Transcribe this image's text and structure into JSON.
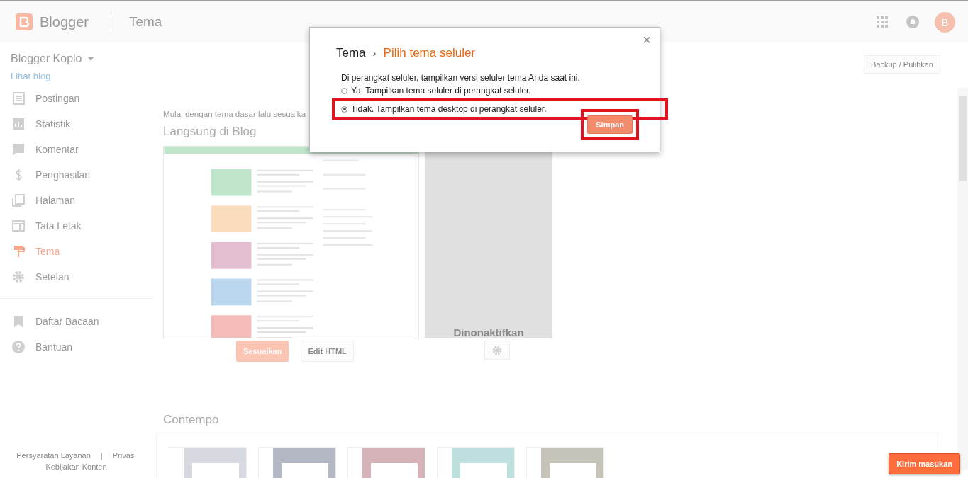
{
  "header": {
    "logo_text": "Blogger",
    "page_title": "Tema",
    "avatar_letter": "B"
  },
  "sidebar": {
    "blog_name": "Blogger Koplo",
    "view_blog_link": "Lihat blog",
    "items": [
      {
        "label": "Postingan",
        "kind": "posts",
        "selected": false
      },
      {
        "label": "Statistik",
        "kind": "stats",
        "selected": false
      },
      {
        "label": "Komentar",
        "kind": "comments",
        "selected": false
      },
      {
        "label": "Penghasilan",
        "kind": "earnings",
        "selected": false
      },
      {
        "label": "Halaman",
        "kind": "pages",
        "selected": false
      },
      {
        "label": "Tata Letak",
        "kind": "layout",
        "selected": false
      },
      {
        "label": "Tema",
        "kind": "theme",
        "selected": true
      },
      {
        "label": "Setelan",
        "kind": "settings",
        "selected": false
      }
    ],
    "secondary_items": [
      {
        "label": "Daftar Bacaan",
        "kind": "bookmark",
        "selected": false
      },
      {
        "label": "Bantuan",
        "kind": "help",
        "selected": false
      }
    ],
    "footer_links": [
      "Persyaratan Layanan",
      "|",
      "Privasi",
      "Kebijakan Konten"
    ]
  },
  "main": {
    "backup_button": "Backup / Pulihkan",
    "intro": "Mulai dengan tema dasar lalu sesuaika",
    "live": {
      "title": "Langsung di Blog",
      "mobile_status": "Dinonaktifkan",
      "customize_button": "Sesuaikan",
      "edit_html_button": "Edit HTML"
    },
    "gallery": {
      "title": "Contempo",
      "thumbnails": [
        {
          "color": "#d6d9df"
        },
        {
          "color": "#b3b8c4"
        },
        {
          "color": "#d5b3b8"
        },
        {
          "color": "#bfe0df"
        },
        {
          "color": "#c6c3b8"
        }
      ]
    }
  },
  "feedback_button": "Kirim masukan",
  "dialog": {
    "breadcrumb": "Tema",
    "separator": "›",
    "title": "Pilih tema seluler",
    "close": "×",
    "prompt": "Di perangkat seluler, tampilkan versi seluler tema Anda saat ini.",
    "options": [
      {
        "label": "Ya. Tampilkan tema seluler di perangkat seluler.",
        "selected": false,
        "highlighted": false
      },
      {
        "label": "Tidak. Tampilkan tema desktop di perangkat seluler.",
        "selected": true,
        "highlighted": true
      }
    ],
    "save_button": {
      "label": "Simpan",
      "highlighted": true
    }
  }
}
